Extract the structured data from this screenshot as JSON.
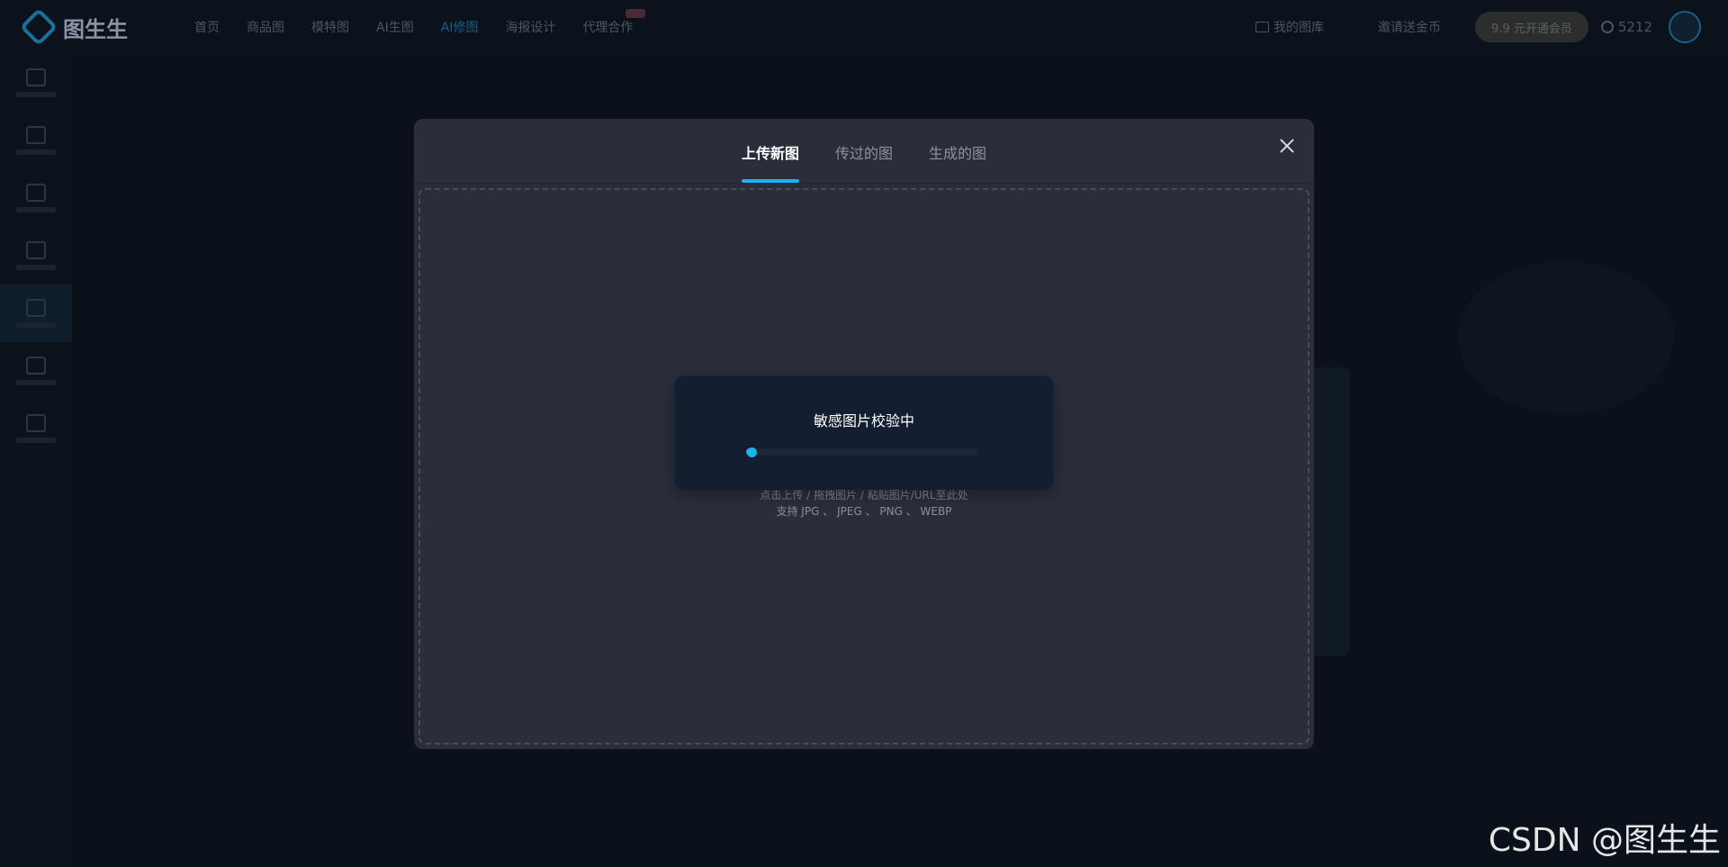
{
  "app": {
    "brand": "图生生",
    "nav": [
      {
        "label": "首页"
      },
      {
        "label": "商品图"
      },
      {
        "label": "模特图"
      },
      {
        "label": "AI生图"
      },
      {
        "label": "AI修图",
        "active": true
      },
      {
        "label": "海报设计"
      },
      {
        "label": "代理合作",
        "badge": true
      }
    ],
    "gallery_label": "我的图库",
    "invite_label": "邀请送金币",
    "vip_label": "9.9 元开通会员",
    "coins": "5212",
    "sidebar_icons": [
      "crop-icon",
      "edit-icon",
      "image-icon",
      "shapes-icon",
      "brush-icon",
      "layers-icon",
      "frame-icon"
    ]
  },
  "modal": {
    "tabs": [
      {
        "label": "上传新图",
        "active": true
      },
      {
        "label": "传过的图"
      },
      {
        "label": "生成的图"
      }
    ],
    "hint_line1": "点击上传 / 拖拽图片 / 粘贴图片/URL至此处",
    "hint_line2": "支持 JPG 、 JPEG 、 PNG 、 WEBP"
  },
  "check_dialog": {
    "title": "敏感图片校验中",
    "progress": 0.02
  },
  "watermark": "CSDN @图生生",
  "colors": {
    "accent": "#1eb3ee",
    "modal_bg": "#2a2e3a",
    "dialog_bg": "#131f31",
    "page_bg": "#0a111b"
  }
}
